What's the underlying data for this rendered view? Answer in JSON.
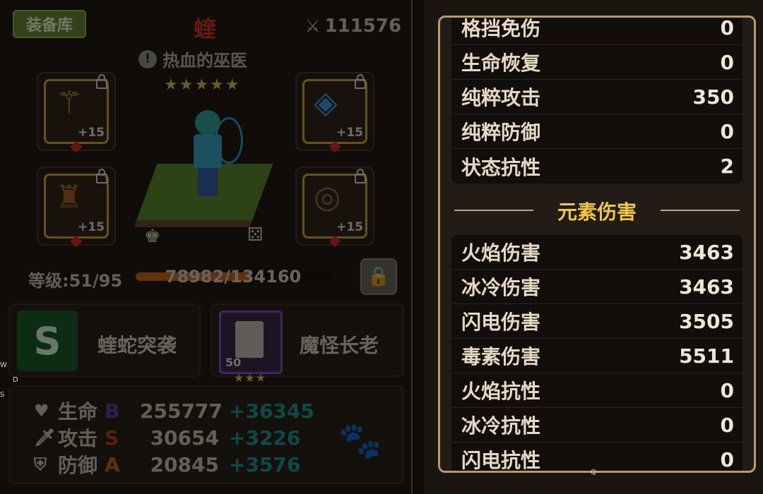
{
  "left_panel": {
    "armory_button": "装备库",
    "character_name": "蝰",
    "power": "111576",
    "subtitle": "热血的巫医",
    "stars": "★★★★★",
    "equipment": [
      {
        "slot": "weapon",
        "level": "+15"
      },
      {
        "slot": "ring",
        "level": "+15"
      },
      {
        "slot": "armor",
        "level": "+15"
      },
      {
        "slot": "necklace",
        "level": "+15"
      }
    ],
    "level_label": "等级:51/95",
    "xp_text": "78982/134160",
    "xp_progress": 0.589,
    "skill_name": "蝰蛇突袭",
    "card_name": "魔怪长老",
    "card_count": "50",
    "card_stars": "★★★",
    "stats": [
      {
        "icon": "heart-icon",
        "name": "生命",
        "grade": "B",
        "grade_color": "#6a3fa8",
        "value": "255777",
        "bonus": "+36345"
      },
      {
        "icon": "sword-icon",
        "name": "攻击",
        "grade": "S",
        "grade_color": "#c0421c",
        "value": "30654",
        "bonus": "+3226"
      },
      {
        "icon": "shield-icon",
        "name": "防御",
        "grade": "A",
        "grade_color": "#c06a1c",
        "value": "20845",
        "bonus": "+3576"
      }
    ]
  },
  "right_panel": {
    "top_attributes": [
      {
        "name": "格挡免伤",
        "value": "0"
      },
      {
        "name": "生命恢复",
        "value": "0"
      },
      {
        "name": "纯粹攻击",
        "value": "350"
      },
      {
        "name": "纯粹防御",
        "value": "0"
      },
      {
        "name": "状态抗性",
        "value": "2"
      }
    ],
    "section_title": "元素伤害",
    "element_attributes": [
      {
        "name": "火焰伤害",
        "value": "3463"
      },
      {
        "name": "冰冷伤害",
        "value": "3463"
      },
      {
        "name": "闪电伤害",
        "value": "3505"
      },
      {
        "name": "毒素伤害",
        "value": "5511"
      },
      {
        "name": "火焰抗性",
        "value": "0"
      },
      {
        "name": "冰冷抗性",
        "value": "0"
      },
      {
        "name": "闪电抗性",
        "value": "0"
      }
    ]
  },
  "edge_labels": {
    "w": "W",
    "d": "D",
    "s": "S",
    "q": "Q"
  },
  "colors": {
    "accent_gold": "#f0c74a",
    "name_red": "#d03a22",
    "bonus_teal": "#1f9a97",
    "panel_border": "#b89a6c"
  }
}
